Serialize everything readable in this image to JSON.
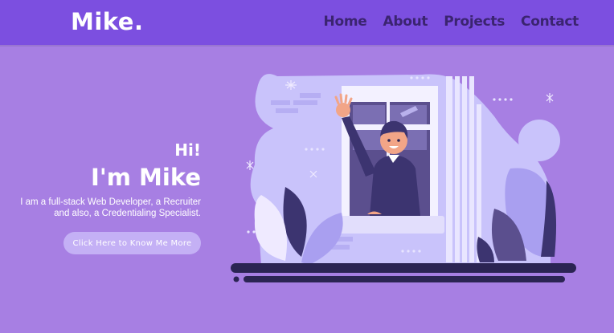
{
  "header": {
    "logo": "Mike.",
    "nav": [
      "Home",
      "About",
      "Projects",
      "Contact"
    ]
  },
  "hero": {
    "greeting": "Hi!",
    "name": "I'm Mike",
    "tagline": "I am a full-stack Web Developer, a Recruiter and also, a Credentialing Specialist.",
    "cta_label": "Click Here to Know Me More"
  },
  "colors": {
    "background": "#a77fe3",
    "navbar": "#7c4fe0",
    "nav_text": "#3b2470",
    "cta": "#c4b0f5",
    "blob": "#c9c3fb",
    "ground": "#2b2453"
  },
  "icons": [
    "sparkle-icon",
    "waving-man-icon",
    "window-icon",
    "leaf-icon"
  ]
}
